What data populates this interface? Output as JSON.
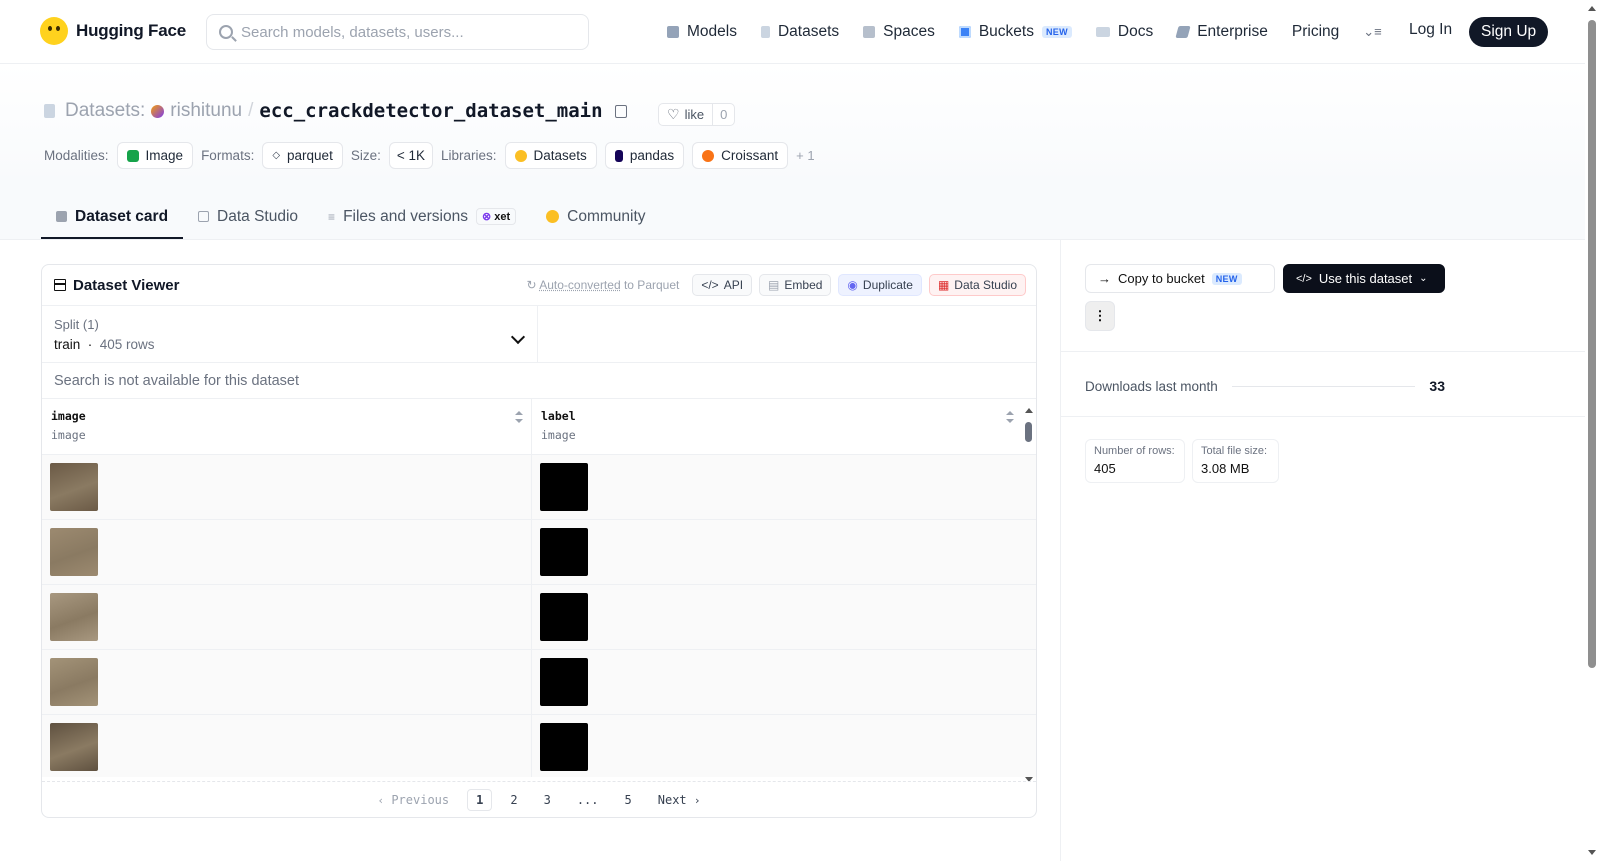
{
  "brand": {
    "name": "Hugging Face"
  },
  "search": {
    "placeholder": "Search models, datasets, users..."
  },
  "nav": {
    "items": [
      {
        "label": "Models"
      },
      {
        "label": "Datasets"
      },
      {
        "label": "Spaces"
      },
      {
        "label": "Buckets",
        "badge": "NEW"
      },
      {
        "label": "Docs"
      },
      {
        "label": "Enterprise"
      },
      {
        "label": "Pricing"
      }
    ],
    "login": "Log In",
    "signup": "Sign Up"
  },
  "repo": {
    "type_label": "Datasets:",
    "owner": "rishitunu",
    "separator": "/",
    "name": "ecc_crackdetector_dataset_main",
    "like_label": "like",
    "like_count": "0"
  },
  "tags": {
    "modalities_label": "Modalities:",
    "modalities": [
      "Image"
    ],
    "formats_label": "Formats:",
    "formats": [
      "parquet"
    ],
    "size_label": "Size:",
    "size": "< 1K",
    "libraries_label": "Libraries:",
    "libraries": [
      "Datasets",
      "pandas",
      "Croissant"
    ],
    "more": "+ 1"
  },
  "tabs": [
    {
      "label": "Dataset card",
      "active": true
    },
    {
      "label": "Data Studio"
    },
    {
      "label": "Files and versions",
      "badge": "xet"
    },
    {
      "label": "Community"
    }
  ],
  "viewer": {
    "title": "Dataset Viewer",
    "autoconv_link": "Auto-converted",
    "autoconv_rest": "to Parquet",
    "actions": {
      "api": "API",
      "embed": "Embed",
      "duplicate": "Duplicate",
      "studio": "Data Studio"
    },
    "split": {
      "title": "Split (1)",
      "name": "train",
      "rows": "405 rows"
    },
    "search_placeholder": "Search is not available for this dataset",
    "columns": [
      {
        "name": "image",
        "type": "image"
      },
      {
        "name": "label",
        "type": "image"
      }
    ],
    "row_count_visible": 5,
    "pager": {
      "prev": "Previous",
      "pages": [
        "1",
        "2",
        "3",
        "...",
        "5"
      ],
      "current": "1",
      "next": "Next"
    }
  },
  "sidebar": {
    "copy_bucket": "Copy to bucket",
    "copy_bucket_badge": "NEW",
    "use_dataset": "Use this dataset",
    "downloads_label": "Downloads last month",
    "downloads_value": "33",
    "rows_label": "Number of rows:",
    "rows_value": "405",
    "size_label": "Total file size:",
    "size_value": "3.08 MB"
  },
  "colors": {
    "accent_dark": "#0b0f1a",
    "brand_yellow": "#ffd21e"
  }
}
